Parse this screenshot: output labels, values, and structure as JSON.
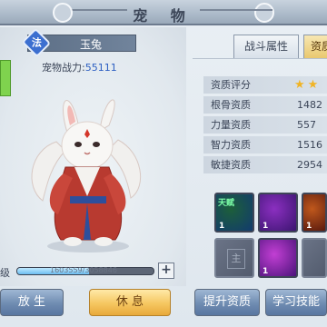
{
  "window": {
    "title": "宠 物"
  },
  "pet": {
    "type_badge": "法",
    "name": "玉兔",
    "power_label": "宠物战力:",
    "power_value": "55111",
    "exp_label": "级",
    "exp_text": "1603559/3058846",
    "exp_progress": 0.524
  },
  "tabs": [
    {
      "label": "战斗属性",
      "active": false
    },
    {
      "label": "资质",
      "active": true
    }
  ],
  "stats": [
    {
      "label": "资质评分",
      "value": "",
      "stars": "★★"
    },
    {
      "label": "根骨资质",
      "value": "1482"
    },
    {
      "label": "力量资质",
      "value": "557"
    },
    {
      "label": "智力资质",
      "value": "1516"
    },
    {
      "label": "敏捷资质",
      "value": "2954"
    }
  ],
  "skills": [
    {
      "name": "skill-1",
      "level": "1",
      "colors": [
        "#1d5f3a",
        "#123b6e"
      ],
      "icon_text": "天赋"
    },
    {
      "name": "skill-2",
      "level": "1",
      "colors": [
        "#8b2fc0",
        "#3b1570"
      ]
    },
    {
      "name": "skill-3",
      "level": "1",
      "colors": [
        "#c0581c",
        "#5a1a0e"
      ]
    },
    {
      "name": "skill-4",
      "level": "",
      "empty": true,
      "icon_text": "主"
    },
    {
      "name": "skill-5",
      "level": "1",
      "colors": [
        "#c23fd4",
        "#4b137a"
      ]
    },
    {
      "name": "skill-6",
      "level": "",
      "empty": true,
      "icon_text": ""
    }
  ],
  "buttons": {
    "release": "放 生",
    "rest": "休 息",
    "upgrade": "提升资质",
    "learn": "学习技能"
  },
  "plus_symbol": "+"
}
